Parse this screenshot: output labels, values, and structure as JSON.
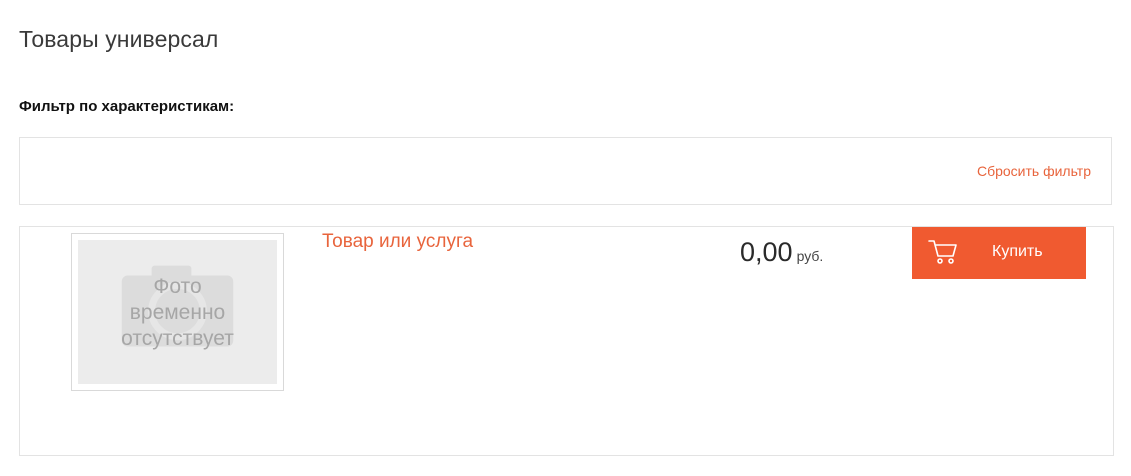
{
  "page": {
    "title": "Товары универсал"
  },
  "filter": {
    "heading": "Фильтр по характеристикам:",
    "reset_label": "Сбросить фильтр"
  },
  "product": {
    "photo_placeholder_text": "Фото\nвременно\nотсутствует",
    "name": "Товар или услуга",
    "price": "0,00",
    "currency": "руб.",
    "buy_label": "Купить",
    "buy_icon": "shopping-cart-icon"
  },
  "colors": {
    "accent": "#f05a30",
    "link": "#e8643c"
  }
}
